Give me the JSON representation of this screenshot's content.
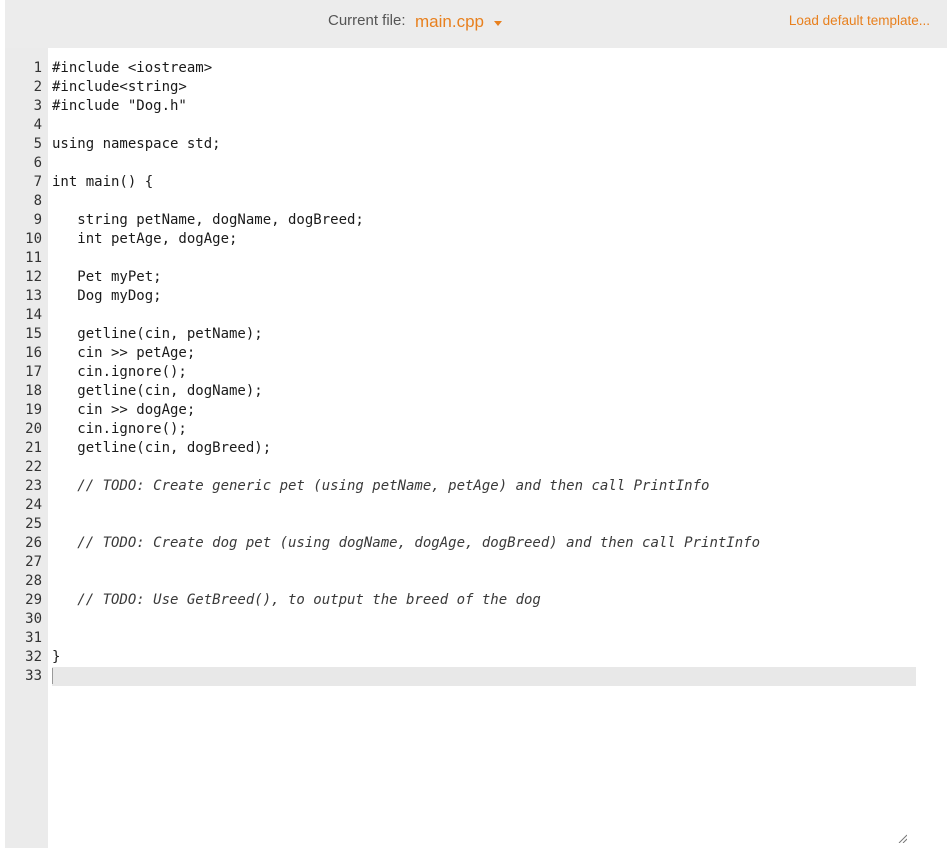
{
  "toolbar": {
    "current_file_label": "Current file:",
    "current_file_name": "main.cpp",
    "load_template_label": "Load default template..."
  },
  "editor": {
    "lines": [
      {
        "n": "1",
        "text": "#include <iostream>"
      },
      {
        "n": "2",
        "text": "#include<string>"
      },
      {
        "n": "3",
        "text": "#include \"Dog.h\""
      },
      {
        "n": "4",
        "text": ""
      },
      {
        "n": "5",
        "text": "using namespace std;"
      },
      {
        "n": "6",
        "text": ""
      },
      {
        "n": "7",
        "text": "int main() {"
      },
      {
        "n": "8",
        "text": ""
      },
      {
        "n": "9",
        "text": "   string petName, dogName, dogBreed;"
      },
      {
        "n": "10",
        "text": "   int petAge, dogAge;"
      },
      {
        "n": "11",
        "text": ""
      },
      {
        "n": "12",
        "text": "   Pet myPet;"
      },
      {
        "n": "13",
        "text": "   Dog myDog;"
      },
      {
        "n": "14",
        "text": ""
      },
      {
        "n": "15",
        "text": "   getline(cin, petName);"
      },
      {
        "n": "16",
        "text": "   cin >> petAge;"
      },
      {
        "n": "17",
        "text": "   cin.ignore();"
      },
      {
        "n": "18",
        "text": "   getline(cin, dogName);"
      },
      {
        "n": "19",
        "text": "   cin >> dogAge;"
      },
      {
        "n": "20",
        "text": "   cin.ignore();"
      },
      {
        "n": "21",
        "text": "   getline(cin, dogBreed);"
      },
      {
        "n": "22",
        "text": ""
      },
      {
        "n": "23",
        "text": "   // TODO: Create generic pet (using petName, petAge) and then call PrintInfo"
      },
      {
        "n": "24",
        "text": ""
      },
      {
        "n": "25",
        "text": ""
      },
      {
        "n": "26",
        "text": "   // TODO: Create dog pet (using dogName, dogAge, dogBreed) and then call PrintInfo"
      },
      {
        "n": "27",
        "text": ""
      },
      {
        "n": "28",
        "text": ""
      },
      {
        "n": "29",
        "text": "   // TODO: Use GetBreed(), to output the breed of the dog"
      },
      {
        "n": "30",
        "text": ""
      },
      {
        "n": "31",
        "text": ""
      },
      {
        "n": "32",
        "text": "}"
      },
      {
        "n": "33",
        "text": ""
      }
    ],
    "active_line": 33
  }
}
